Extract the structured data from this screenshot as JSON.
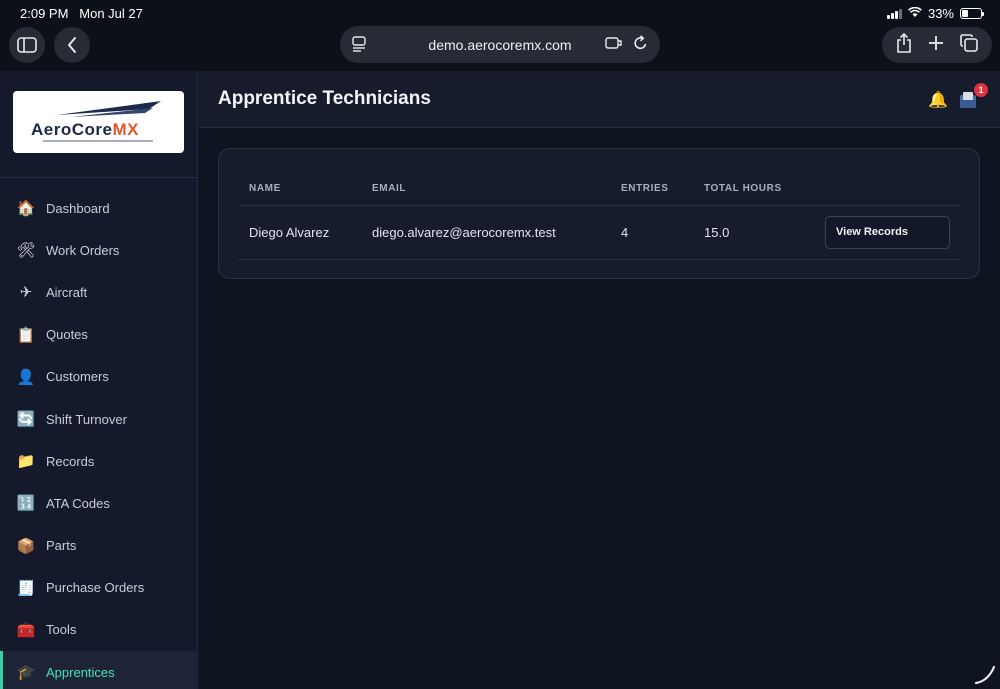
{
  "status_bar": {
    "time": "2:09 PM",
    "date": "Mon Jul 27",
    "battery": "33%",
    "battery_level": 0.33
  },
  "browser": {
    "url": "demo.aerocoremx.com",
    "icons": [
      "sidebar-toggle-icon",
      "back-icon",
      "page-menu-icon",
      "extensions-icon",
      "reload-icon",
      "share-icon",
      "new-tab-icon",
      "tabs-icon"
    ]
  },
  "brand": {
    "logo_text_a": "AeroCore",
    "logo_text_b": "MX",
    "accent": "#e8552d",
    "primary": "#1b2a4a"
  },
  "sidebar": {
    "items": [
      {
        "label": "Dashboard",
        "icon": "house-icon"
      },
      {
        "label": "Work Orders",
        "icon": "tools-icon"
      },
      {
        "label": "Aircraft",
        "icon": "airplane-icon"
      },
      {
        "label": "Quotes",
        "icon": "clipboard-icon"
      },
      {
        "label": "Customers",
        "icon": "person-icon"
      },
      {
        "label": "Shift Turnover",
        "icon": "cycle-icon"
      },
      {
        "label": "Records",
        "icon": "folder-icon"
      },
      {
        "label": "ATA Codes",
        "icon": "numbers-icon"
      },
      {
        "label": "Parts",
        "icon": "package-icon"
      },
      {
        "label": "Purchase Orders",
        "icon": "receipt-icon"
      },
      {
        "label": "Tools",
        "icon": "toolbox-icon"
      },
      {
        "label": "Apprentices",
        "icon": "graduation-cap-icon",
        "active": true
      }
    ],
    "active_color": "#48e0b5"
  },
  "header": {
    "title": "Apprentice Technicians",
    "notification_count": "1"
  },
  "table": {
    "columns": [
      "NAME",
      "EMAIL",
      "ENTRIES",
      "TOTAL HOURS"
    ],
    "rows": [
      {
        "name": "Diego Alvarez",
        "email": "diego.alvarez@aerocoremx.test",
        "entries": "4",
        "hours": "15.0",
        "action": "View Records"
      }
    ]
  }
}
